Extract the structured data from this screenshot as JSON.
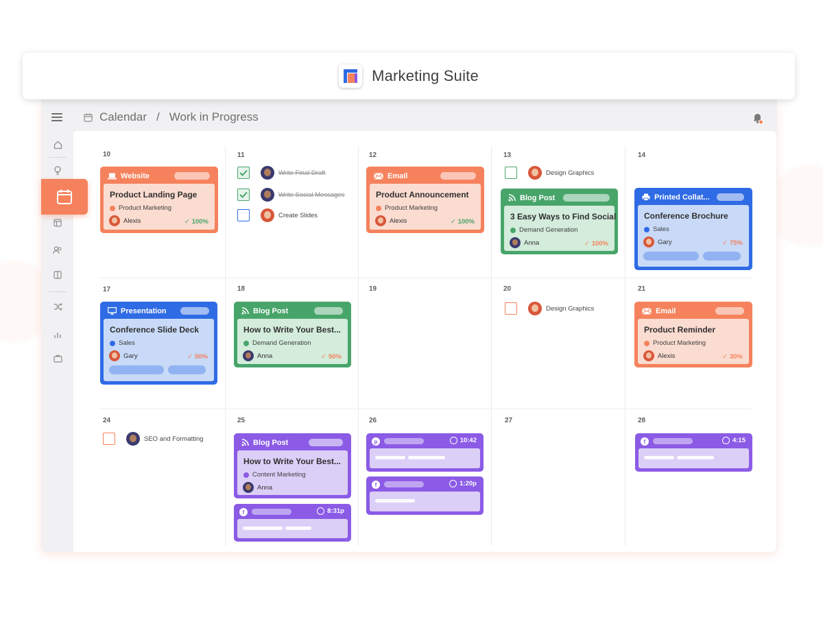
{
  "app": {
    "title": "Marketing Suite"
  },
  "breadcrumb": {
    "root": "Calendar",
    "separator": "/",
    "current": "Work in Progress"
  },
  "colors": {
    "orange": "#f5825c",
    "green": "#48a56a",
    "blue": "#2f6be4",
    "purple": "#8b5be6"
  },
  "sidebar": {
    "icons": [
      "home-icon",
      "lightbulb-icon",
      "calendar-icon",
      "layout-icon",
      "users-icon",
      "columns-icon",
      "shuffle-icon",
      "bar-chart-icon",
      "briefcase-icon"
    ]
  },
  "days": {
    "d10": "10",
    "d11": "11",
    "d12": "12",
    "d13": "13",
    "d14": "14",
    "d17": "17",
    "d18": "18",
    "d19": "19",
    "d20": "20",
    "d21": "21",
    "d24": "24",
    "d25": "25",
    "d26": "26",
    "d27": "27",
    "d28": "28"
  },
  "cards": {
    "website": {
      "type": "Website",
      "title": "Product Landing Page",
      "tag": "Product Marketing",
      "assignee": "Alexis",
      "progress": "100%"
    },
    "email1": {
      "type": "Email",
      "title": "Product Announcement",
      "tag": "Product Marketing",
      "assignee": "Alexis",
      "progress": "100%"
    },
    "blog13": {
      "type": "Blog Post",
      "title": "3 Easy Ways to Find Social...",
      "tag": "Demand Generation",
      "assignee": "Anna",
      "progress": "100%"
    },
    "printed": {
      "type": "Printed Collat...",
      "title": "Conference Brochure",
      "tag": "Sales",
      "assignee": "Gary",
      "progress": "75%"
    },
    "presentation": {
      "type": "Presentation",
      "title": "Conference Slide Deck",
      "tag": "Sales",
      "assignee": "Gary",
      "progress": "50%"
    },
    "blog18": {
      "type": "Blog Post",
      "title": "How to Write Your Best...",
      "tag": "Demand Generation",
      "assignee": "Anna",
      "progress": "50%"
    },
    "email2": {
      "type": "Email",
      "title": "Product Reminder",
      "tag": "Product Marketing",
      "assignee": "Alexis",
      "progress": "30%"
    },
    "blog25": {
      "type": "Blog Post",
      "title": "How to Write Your Best...",
      "tag": "Content Marketing",
      "assignee": "Anna"
    }
  },
  "todos": {
    "t1": {
      "label": "Write Final Draft",
      "done": true
    },
    "t2": {
      "label": "Write Social Messages",
      "done": true
    },
    "t3": {
      "label": "Create Slides",
      "done": false
    },
    "t4": {
      "label": "Design Graphics",
      "done": false
    },
    "t5": {
      "label": "Design Graphics",
      "done": false
    },
    "t6": {
      "label": "SEO and Formatting",
      "done": false
    }
  },
  "social": {
    "s25": {
      "network": "f",
      "time": "8:31p"
    },
    "s26a": {
      "network": "p",
      "time": "10:42"
    },
    "s26b": {
      "network": "f",
      "time": "1:20p"
    },
    "s28": {
      "network": "f",
      "time": "4:15"
    }
  }
}
